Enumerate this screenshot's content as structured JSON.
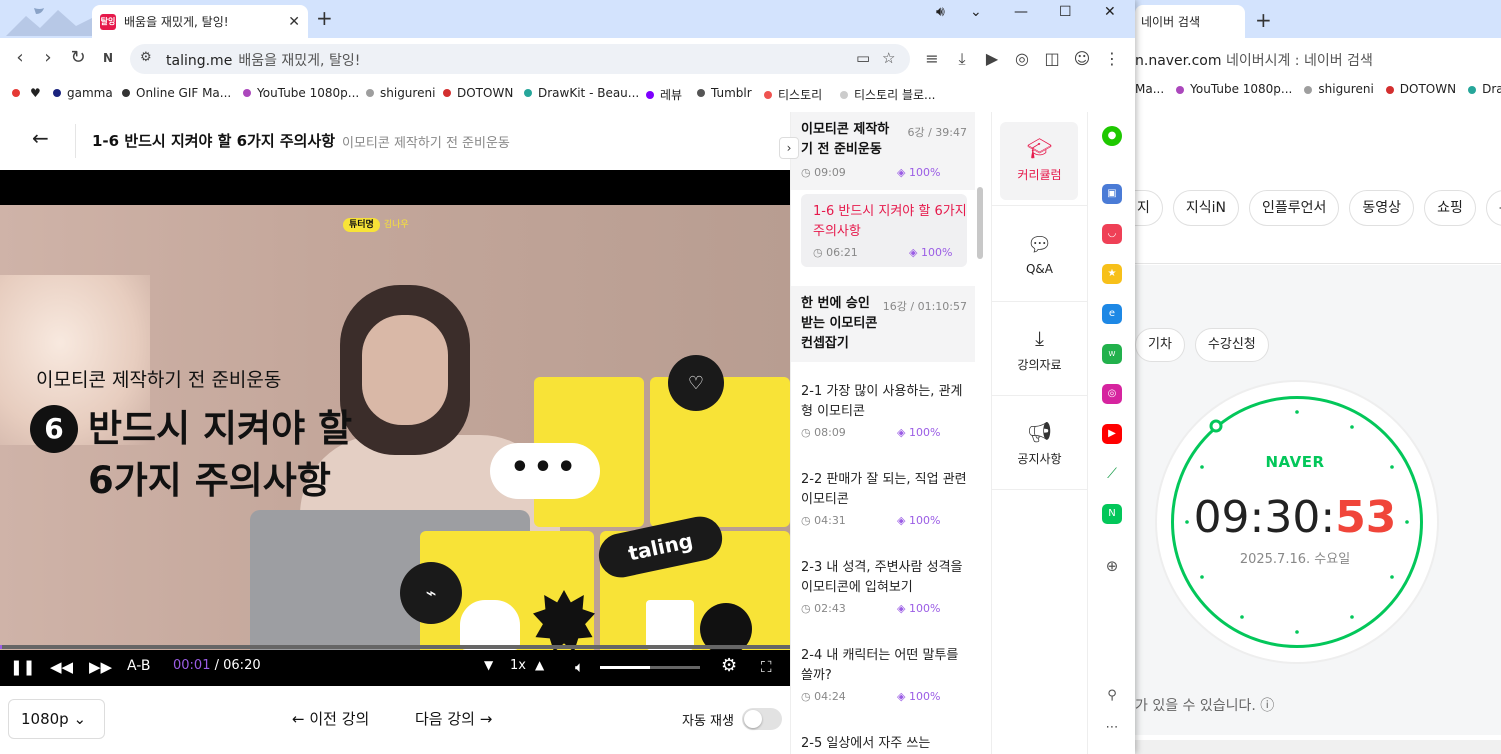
{
  "browser": {
    "tab_title": "배움을 재밌게, 탈잉!",
    "favicon_text": "탈잉",
    "url_domain": "taling.me",
    "url_path": "배움을 재밌게, 탈잉!"
  },
  "bookmarks": [
    {
      "label": "",
      "color": "#e53935"
    },
    {
      "label": "♥",
      "color": "#111111"
    },
    {
      "label": "gamma",
      "color": "#1a237e"
    },
    {
      "label": "Online GIF Ma...",
      "color": "#333333"
    },
    {
      "label": "YouTube 1080p...",
      "color": "#ab47bc"
    },
    {
      "label": "shigureni",
      "color": "#9e9e9e"
    },
    {
      "label": "DOTOWN",
      "color": "#d32f2f"
    },
    {
      "label": "DrawKit - Beau...",
      "color": "#26a69a"
    },
    {
      "label": "레뷰",
      "color": "#7e00ff"
    },
    {
      "label": "Tumblr",
      "color": "#555555"
    },
    {
      "label": "티스토리",
      "color": "#ef5350"
    },
    {
      "label": "티스토리 블로...",
      "color": "#cccccc"
    }
  ],
  "lecture": {
    "title": "1-6 반드시 지켜야 할 6가지 주의사항",
    "subtitle": "이모티콘 제작하기 전 준비운동"
  },
  "video": {
    "tutor_tag": "튜터명",
    "tutor_name": "김나우",
    "overlay_subtitle": "이모티콘 제작하기 전 준비운동",
    "overlay_number": "6",
    "overlay_title_line1": "반드시 지켜야 할",
    "overlay_title_line2": "6가지 주의사항",
    "bubble_text": "•••",
    "pill_text": "taling",
    "progress": 0.003,
    "volume": 0.5,
    "ab_label": "A-B",
    "current_time": "00:01",
    "time_sep": "/",
    "duration": "06:20",
    "speed": "1x"
  },
  "below_video": {
    "quality": "1080p",
    "prev_label": "이전 강의",
    "next_label": "다음 강의",
    "autoplay_label": "자동 재생"
  },
  "curriculum": {
    "section1": {
      "title": "이모티콘 제작하기 전 준비운동",
      "meta": "6강 / 39:47"
    },
    "partial_time": "09:09",
    "partial_pct": "100%",
    "active_lesson": {
      "title": "1-6 반드시 지켜야 할 6가지 주의사항",
      "time": "06:21",
      "pct": "100%"
    },
    "section2": {
      "title": "한 번에 승인 받는 이모티콘 컨셉잡기",
      "meta": "16강 / 01:10:57"
    },
    "lessons": [
      {
        "title": "2-1 가장 많이 사용하는, 관계형 이모티콘",
        "time": "08:09",
        "pct": "100%"
      },
      {
        "title": "2-2 판매가 잘 되는, 직업 관련 이모티콘",
        "time": "04:31",
        "pct": "100%"
      },
      {
        "title": "2-3 내 성격, 주변사람 성격을 이모티콘에 입혀보기",
        "time": "02:43",
        "pct": "100%"
      },
      {
        "title": "2-4 내 캐릭터는 어떤 말투를 쓸까?",
        "time": "04:24",
        "pct": "100%"
      },
      {
        "title": "2-5 일상에서 자주 쓰는",
        "time": "",
        "pct": ""
      }
    ]
  },
  "right_menu": [
    {
      "label": "커리큘럼",
      "icon": "graduation-cap-icon"
    },
    {
      "label": "Q&A",
      "icon": "chat-bubble-icon"
    },
    {
      "label": "강의자료",
      "icon": "download-icon"
    },
    {
      "label": "공지사항",
      "icon": "megaphone-icon"
    }
  ],
  "naver": {
    "tab_title": "네이버 검색",
    "url_domain": "n.naver.com",
    "url_path": "네이버시계 : 네이버 검색",
    "bookmarks": [
      "Ma...",
      "YouTube 1080p...",
      "shigureni",
      "DOTOWN",
      "Draw"
    ],
    "chips": [
      "지",
      "지식iN",
      "인플루언서",
      "동영상",
      "쇼핑",
      "뉴"
    ],
    "chips2": [
      "기차",
      "수강신청"
    ],
    "logo": "NAVER",
    "time_hm": "09:30:",
    "time_s": "53",
    "date": "2025.7.16. 수요일",
    "notice": "가 있을 수 있습니다. ⓘ"
  }
}
